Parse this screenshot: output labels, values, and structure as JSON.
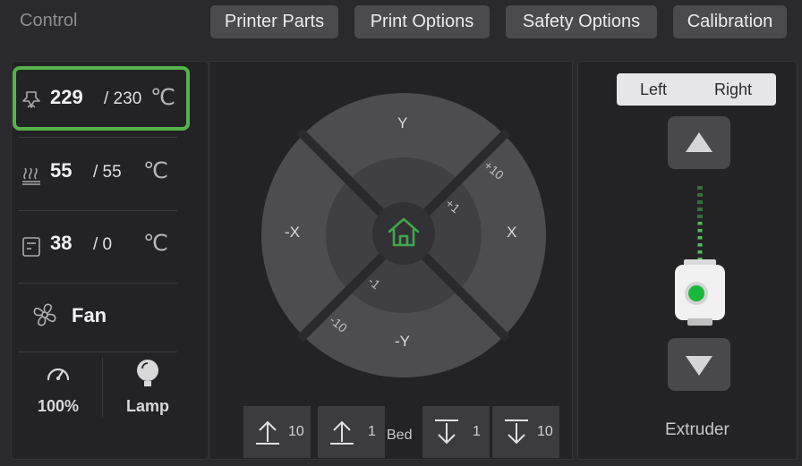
{
  "header": {
    "title": "Control",
    "tabs": [
      {
        "label": "Printer Parts"
      },
      {
        "label": "Print Options"
      },
      {
        "label": "Safety Options"
      },
      {
        "label": "Calibration"
      }
    ]
  },
  "temps": {
    "nozzle": {
      "current": "229",
      "target": "/ 230",
      "unit": "℃",
      "icon": "nozzle-icon"
    },
    "bed": {
      "current": "55",
      "target": "/ 55",
      "unit": "℃",
      "icon": "heatbed-icon"
    },
    "chamber": {
      "current": "38",
      "target": "/ 0",
      "unit": "℃",
      "icon": "chamber-icon"
    }
  },
  "fan": {
    "label": "Fan",
    "icon": "fan-icon"
  },
  "speed": {
    "label": "100%",
    "icon": "speedometer-icon"
  },
  "lamp": {
    "label": "Lamp",
    "icon": "lamp-icon"
  },
  "jog": {
    "y_plus": "Y",
    "y_minus": "-Y",
    "x_plus": "X",
    "x_minus": "-X",
    "step_plus10": "+10",
    "step_plus1": "+1",
    "step_minus1": "-1",
    "step_minus10": "-10",
    "home_icon": "home-icon"
  },
  "z_axis": {
    "bed_label": "Bed",
    "buttons": [
      {
        "dir": "up",
        "step": "10"
      },
      {
        "dir": "up",
        "step": "1"
      },
      {
        "dir": "down",
        "step": "1"
      },
      {
        "dir": "down",
        "step": "10"
      }
    ]
  },
  "extruder": {
    "switch_left": "Left",
    "switch_right": "Right",
    "label": "Extruder"
  },
  "colors": {
    "accent": "#55b44a",
    "background": "#2a2a2e",
    "panel": "#232326"
  }
}
